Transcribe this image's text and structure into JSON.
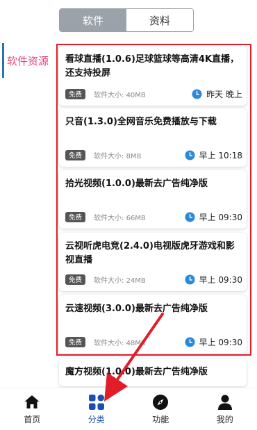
{
  "tabs": [
    {
      "label": "软件",
      "active": true
    },
    {
      "label": "资料",
      "active": false
    }
  ],
  "category": {
    "label": "软件资源"
  },
  "items": [
    {
      "title": "看球直播(1.0.6)足球篮球等高清4K直播，还支持投屏",
      "badge": "免费",
      "size": "软件大小: 40MB",
      "time": "昨天 晚上"
    },
    {
      "title": "只音(1.3.0)全网音乐免费播放与下载",
      "badge": "免费",
      "size": "软件大小: 8MB",
      "time": "早上 10:18"
    },
    {
      "title": "拾光视频(1.0.0)最新去广告纯净版",
      "badge": "免费",
      "size": "软件大小: 66MB",
      "time": "早上 09:30"
    },
    {
      "title": "云视听虎电竞(2.4.0)电视版虎牙游戏和影视直播",
      "badge": "免费",
      "size": "软件大小: 24MB",
      "time": "早上 09:30"
    },
    {
      "title": "云速视频(3.0.0)最新去广告纯净版",
      "badge": "免费",
      "size": "软件大小: 48MB",
      "time": "早上 09:30"
    },
    {
      "title": "魔方视频(1.0.0)最新去广告纯净版"
    }
  ],
  "bottom_nav": [
    {
      "label": "首页",
      "icon": "home-icon"
    },
    {
      "label": "分类",
      "icon": "grid-icon",
      "active": true
    },
    {
      "label": "功能",
      "icon": "compass-icon"
    },
    {
      "label": "我的",
      "icon": "user-icon"
    }
  ],
  "colors": {
    "accent_pink": "#e0457b",
    "nav_active": "#1b4fb0",
    "highlight_red": "#e11d2a",
    "clock_blue": "#2a8ad9"
  }
}
